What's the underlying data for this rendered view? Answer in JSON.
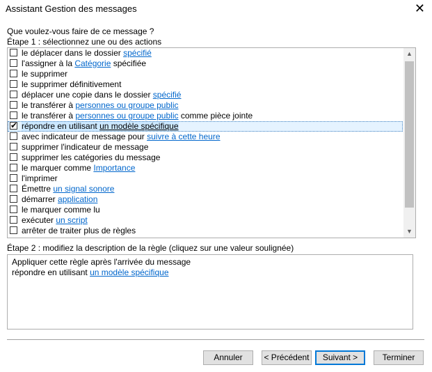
{
  "window": {
    "title": "Assistant Gestion des messages"
  },
  "question": "Que voulez-vous faire de ce message ?",
  "step1_label": "Étape 1 : sélectionnez une ou des actions",
  "actions": [
    {
      "before": "le déplacer dans le dossier ",
      "link": "spécifié",
      "after": "",
      "checked": false
    },
    {
      "before": "l'assigner à la ",
      "link": "Catégorie",
      "after": " spécifiée",
      "checked": false
    },
    {
      "before": "le supprimer",
      "link": "",
      "after": "",
      "checked": false
    },
    {
      "before": "le supprimer définitivement",
      "link": "",
      "after": "",
      "checked": false
    },
    {
      "before": "déplacer une copie dans le dossier ",
      "link": "spécifié",
      "after": "",
      "checked": false
    },
    {
      "before": "le transférer à ",
      "link": "personnes ou groupe public",
      "after": "",
      "checked": false
    },
    {
      "before": "le transférer à ",
      "link": "personnes ou groupe public",
      "after": " comme pièce jointe",
      "checked": false
    },
    {
      "before": "répondre en utilisant ",
      "link": "un modèle spécifique",
      "after": "",
      "checked": true
    },
    {
      "before": "avec indicateur de message pour ",
      "link": "suivre à cette heure",
      "after": "",
      "checked": false
    },
    {
      "before": "supprimer l'indicateur de message",
      "link": "",
      "after": "",
      "checked": false
    },
    {
      "before": "supprimer les catégories du message",
      "link": "",
      "after": "",
      "checked": false
    },
    {
      "before": "le marquer comme ",
      "link": "Importance",
      "after": "",
      "checked": false
    },
    {
      "before": "l'imprimer",
      "link": "",
      "after": "",
      "checked": false
    },
    {
      "before": "Émettre ",
      "link": "un signal sonore",
      "after": "",
      "checked": false
    },
    {
      "before": "démarrer ",
      "link": "application",
      "after": "",
      "checked": false
    },
    {
      "before": "le marquer comme lu",
      "link": "",
      "after": "",
      "checked": false
    },
    {
      "before": "exécuter ",
      "link": "un script",
      "after": "",
      "checked": false
    },
    {
      "before": "arrêter de traiter plus de règles",
      "link": "",
      "after": "",
      "checked": false
    }
  ],
  "step2_label": "Étape 2 : modifiez la description de la règle (cliquez sur une valeur soulignée)",
  "description": {
    "line1": "Appliquer cette règle après l'arrivée du message",
    "line2_text": "répondre en utilisant ",
    "line2_link": "un modèle spécifique"
  },
  "buttons": {
    "cancel": "Annuler",
    "previous": "< Précédent",
    "next": "Suivant >",
    "finish": "Terminer"
  },
  "colors": {
    "link": "#0066cc",
    "selection": "#cce8ff",
    "focus_border": "#0078d7"
  }
}
